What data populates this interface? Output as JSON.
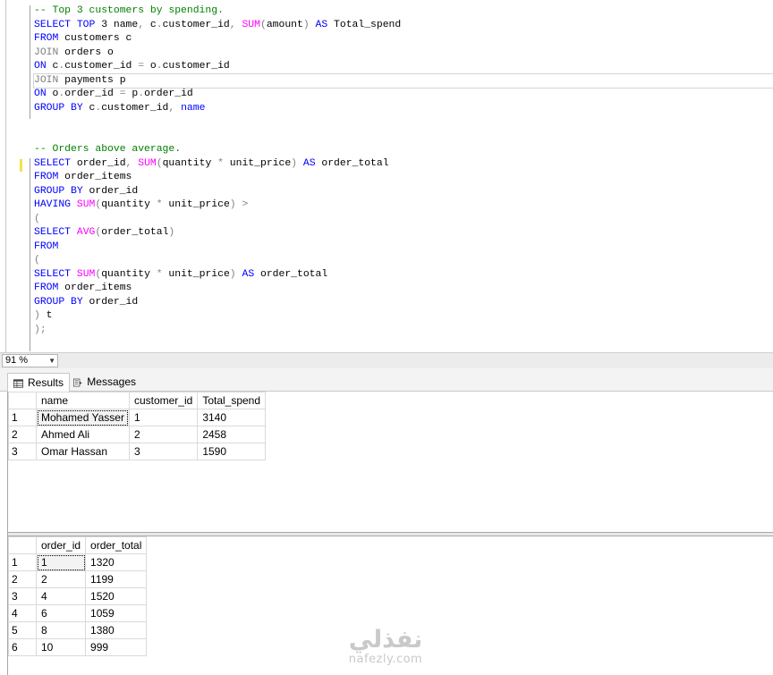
{
  "editor": {
    "lines": [
      {
        "segments": [
          [
            "cm",
            "-- Top 3 customers by spending."
          ]
        ]
      },
      {
        "segments": [
          [
            "kw",
            "SELECT TOP"
          ],
          [
            "",
            " 3 name"
          ],
          [
            "op",
            ","
          ],
          [
            "",
            " c"
          ],
          [
            "op",
            "."
          ],
          [
            "",
            "customer_id"
          ],
          [
            "op",
            ","
          ],
          [
            "",
            " "
          ],
          [
            "fn",
            "SUM"
          ],
          [
            "op",
            "("
          ],
          [
            "",
            "amount"
          ],
          [
            "op",
            ")"
          ],
          [
            "",
            " "
          ],
          [
            "kw",
            "AS"
          ],
          [
            "",
            " Total_spend"
          ]
        ]
      },
      {
        "segments": [
          [
            "kw",
            "FROM"
          ],
          [
            "",
            " customers c"
          ]
        ]
      },
      {
        "segments": [
          [
            "op",
            "JOIN"
          ],
          [
            "",
            " orders o"
          ]
        ]
      },
      {
        "segments": [
          [
            "kw",
            "ON"
          ],
          [
            "",
            " c"
          ],
          [
            "op",
            "."
          ],
          [
            "",
            "customer_id "
          ],
          [
            "op",
            "="
          ],
          [
            "",
            " o"
          ],
          [
            "op",
            "."
          ],
          [
            "",
            "customer_id"
          ]
        ]
      },
      {
        "segments": [
          [
            "op",
            "JOIN"
          ],
          [
            "",
            " payments p"
          ]
        ],
        "boxed": true
      },
      {
        "segments": [
          [
            "kw",
            "ON"
          ],
          [
            "",
            " o"
          ],
          [
            "op",
            "."
          ],
          [
            "",
            "order_id "
          ],
          [
            "op",
            "="
          ],
          [
            "",
            " p"
          ],
          [
            "op",
            "."
          ],
          [
            "",
            "order_id"
          ]
        ]
      },
      {
        "segments": [
          [
            "kw",
            "GROUP BY"
          ],
          [
            "",
            " c"
          ],
          [
            "op",
            "."
          ],
          [
            "",
            "customer_id"
          ],
          [
            "op",
            ","
          ],
          [
            "",
            " "
          ],
          [
            "kw",
            "name"
          ]
        ]
      },
      {
        "segments": []
      },
      {
        "segments": []
      },
      {
        "segments": [
          [
            "cm",
            "-- Orders above average."
          ]
        ]
      },
      {
        "segments": [
          [
            "kw",
            "SELECT"
          ],
          [
            "",
            " order_id"
          ],
          [
            "op",
            ","
          ],
          [
            "",
            " "
          ],
          [
            "fn",
            "SUM"
          ],
          [
            "op",
            "("
          ],
          [
            "",
            "quantity "
          ],
          [
            "op",
            "*"
          ],
          [
            "",
            " unit_price"
          ],
          [
            "op",
            ")"
          ],
          [
            "",
            " "
          ],
          [
            "kw",
            "AS"
          ],
          [
            "",
            " order_total"
          ]
        ]
      },
      {
        "segments": [
          [
            "kw",
            "FROM"
          ],
          [
            "",
            " order_items"
          ]
        ]
      },
      {
        "segments": [
          [
            "kw",
            "GROUP BY"
          ],
          [
            "",
            " order_id"
          ]
        ]
      },
      {
        "segments": [
          [
            "kw",
            "HAVING"
          ],
          [
            "",
            " "
          ],
          [
            "fn",
            "SUM"
          ],
          [
            "op",
            "("
          ],
          [
            "",
            "quantity "
          ],
          [
            "op",
            "*"
          ],
          [
            "",
            " unit_price"
          ],
          [
            "op",
            ")"
          ],
          [
            "",
            " "
          ],
          [
            "op",
            ">"
          ]
        ]
      },
      {
        "segments": [
          [
            "op",
            "("
          ]
        ]
      },
      {
        "segments": [
          [
            "kw",
            "SELECT"
          ],
          [
            "",
            " "
          ],
          [
            "fn",
            "AVG"
          ],
          [
            "op",
            "("
          ],
          [
            "",
            "order_total"
          ],
          [
            "op",
            ")"
          ]
        ]
      },
      {
        "segments": [
          [
            "kw",
            "FROM"
          ]
        ]
      },
      {
        "segments": [
          [
            "op",
            "("
          ]
        ]
      },
      {
        "segments": [
          [
            "kw",
            "SELECT"
          ],
          [
            "",
            " "
          ],
          [
            "fn",
            "SUM"
          ],
          [
            "op",
            "("
          ],
          [
            "",
            "quantity "
          ],
          [
            "op",
            "*"
          ],
          [
            "",
            " unit_price"
          ],
          [
            "op",
            ")"
          ],
          [
            "",
            " "
          ],
          [
            "kw",
            "AS"
          ],
          [
            "",
            " order_total"
          ]
        ]
      },
      {
        "segments": [
          [
            "kw",
            "FROM"
          ],
          [
            "",
            " order_items"
          ]
        ]
      },
      {
        "segments": [
          [
            "kw",
            "GROUP BY"
          ],
          [
            "",
            " order_id"
          ]
        ]
      },
      {
        "segments": [
          [
            "op",
            ")"
          ],
          [
            "",
            " t"
          ]
        ]
      },
      {
        "segments": [
          [
            "op",
            ");"
          ]
        ]
      }
    ]
  },
  "zoom": {
    "value": "91 %"
  },
  "tabs": {
    "results_label": "Results",
    "messages_label": "Messages"
  },
  "results": {
    "grid1": {
      "columns": [
        "name",
        "customer_id",
        "Total_spend"
      ],
      "rows": [
        {
          "num": "1",
          "cells": [
            "Mohamed Yasser",
            "1",
            "3140"
          ]
        },
        {
          "num": "2",
          "cells": [
            "Ahmed Ali",
            "2",
            "2458"
          ]
        },
        {
          "num": "3",
          "cells": [
            "Omar Hassan",
            "3",
            "1590"
          ]
        }
      ]
    },
    "grid2": {
      "columns": [
        "order_id",
        "order_total"
      ],
      "rows": [
        {
          "num": "1",
          "cells": [
            "1",
            "1320"
          ]
        },
        {
          "num": "2",
          "cells": [
            "2",
            "1199"
          ]
        },
        {
          "num": "3",
          "cells": [
            "4",
            "1520"
          ]
        },
        {
          "num": "4",
          "cells": [
            "6",
            "1059"
          ]
        },
        {
          "num": "5",
          "cells": [
            "8",
            "1380"
          ]
        },
        {
          "num": "6",
          "cells": [
            "10",
            "999"
          ]
        }
      ]
    }
  },
  "watermark": {
    "main": "نفذلي",
    "sub": "nafezly.com"
  }
}
